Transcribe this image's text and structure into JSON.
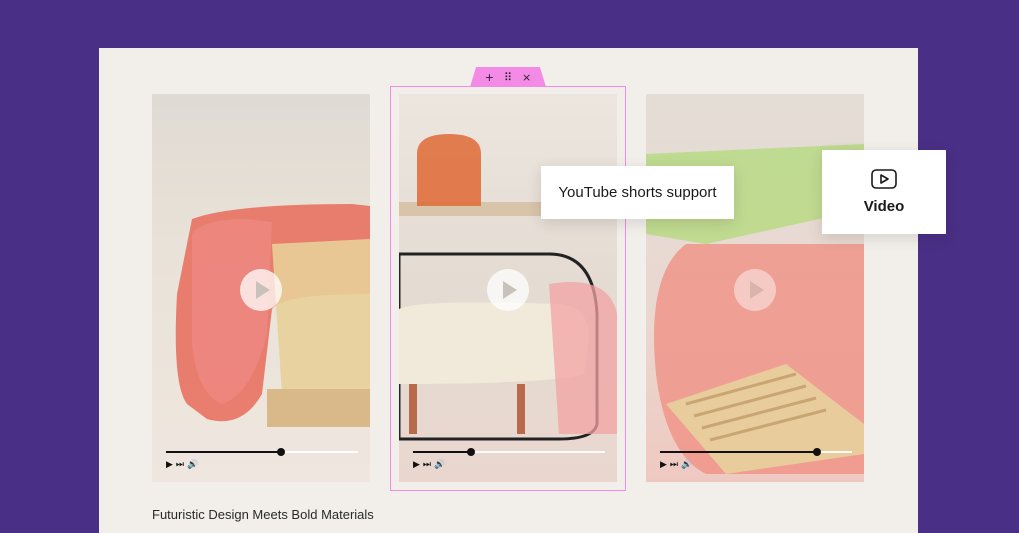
{
  "toolbar": {
    "add_icon": "+",
    "drag_icon": "⠿",
    "close_icon": "×"
  },
  "videos": [
    {
      "progress": 0.6,
      "controls": [
        "▶",
        "⏭",
        "🔊"
      ]
    },
    {
      "progress": 0.3,
      "controls": [
        "▶",
        "⏭",
        "🔊"
      ]
    },
    {
      "progress": 0.82,
      "controls": [
        "▶",
        "⏭",
        "🔊"
      ]
    }
  ],
  "tooltips": {
    "shorts_label": "YouTube shorts support",
    "video_label": "Video"
  },
  "caption": "Futuristic Design Meets Bold Materials",
  "colors": {
    "background": "#4a2f86",
    "selection": "#f28ae6"
  }
}
